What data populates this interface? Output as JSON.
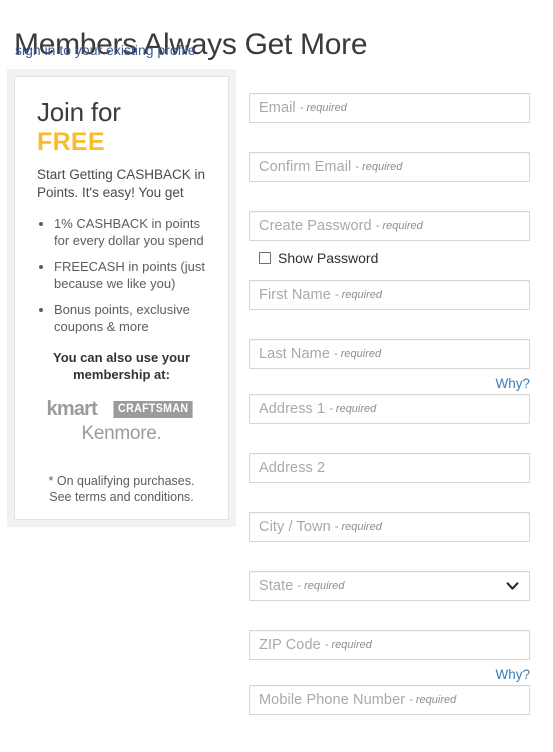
{
  "header": {
    "title": "Members Always Get More",
    "signin_link": "sign in to your existing profile"
  },
  "promo": {
    "join_for": "Join for",
    "free": "FREE",
    "subtext": "Start Getting CASHBACK in Points. It's easy! You get",
    "benefits": [
      "1% CASHBACK in points for every dollar you spend",
      "FREECASH in points (just because we like you)",
      "Bonus points, exclusive coupons & more"
    ],
    "also_use": "You can also use your membership at:",
    "logos": [
      {
        "name": "kmart",
        "label": "kmart"
      },
      {
        "name": "craftsman",
        "label": "CRAFTSMAN"
      },
      {
        "name": "kenmore",
        "label": "Kenmore."
      }
    ],
    "footnote": "* On qualifying purchases. See terms and conditions."
  },
  "form": {
    "required_suffix": "- required",
    "fields": [
      {
        "name": "email",
        "label": "Email",
        "required": true,
        "value": "",
        "type": "email"
      },
      {
        "name": "confirm-email",
        "label": "Confirm Email",
        "required": true,
        "value": "",
        "type": "email"
      },
      {
        "name": "create-password",
        "label": "Create Password",
        "required": true,
        "value": "",
        "type": "password"
      },
      {
        "name": "first-name",
        "label": "First Name",
        "required": true,
        "value": "",
        "type": "text"
      },
      {
        "name": "last-name",
        "label": "Last Name",
        "required": true,
        "value": "",
        "type": "text"
      },
      {
        "name": "address-1",
        "label": "Address 1",
        "required": true,
        "value": "",
        "type": "text"
      },
      {
        "name": "address-2",
        "label": "Address 2",
        "required": false,
        "value": "",
        "type": "text"
      },
      {
        "name": "city-town",
        "label": "City / Town",
        "required": true,
        "value": "",
        "type": "text"
      },
      {
        "name": "state",
        "label": "State",
        "required": true,
        "value": "",
        "type": "select"
      },
      {
        "name": "zip-code",
        "label": "ZIP Code",
        "required": true,
        "value": "",
        "type": "text"
      },
      {
        "name": "mobile-phone",
        "label": "Mobile Phone Number",
        "required": true,
        "value": "",
        "type": "tel"
      }
    ],
    "show_password_label": "Show Password",
    "show_password_checked": false,
    "why_label": "Why?",
    "state_selected": ""
  },
  "colors": {
    "accent_yellow": "#f9bc2c",
    "link_blue": "#3b7cb8",
    "signin_blue": "#3d5a96",
    "border_gray": "#d6d6d6",
    "panel_gray": "#f2f2f2",
    "logo_gray": "#9b9b9b"
  }
}
